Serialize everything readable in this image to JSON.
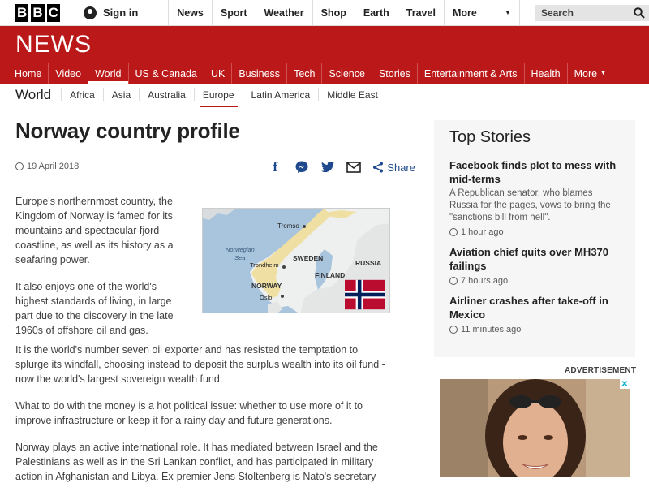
{
  "topbar": {
    "logo_letters": [
      "B",
      "B",
      "C"
    ],
    "signin_label": "Sign in",
    "nav": [
      "News",
      "Sport",
      "Weather",
      "Shop",
      "Earth",
      "Travel"
    ],
    "more_label": "More",
    "search_placeholder": "Search"
  },
  "banner": {
    "title": "NEWS",
    "color": "#bb1919"
  },
  "mainnav": {
    "items": [
      "Home",
      "Video",
      "World",
      "US & Canada",
      "UK",
      "Business",
      "Tech",
      "Science",
      "Stories",
      "Entertainment & Arts",
      "Health",
      "More"
    ],
    "active": "World"
  },
  "subnav": {
    "section": "World",
    "items": [
      "Africa",
      "Asia",
      "Australia",
      "Europe",
      "Latin America",
      "Middle East"
    ],
    "active": "Europe"
  },
  "article": {
    "title": "Norway country profile",
    "date": "19 April 2018",
    "share_label": "Share",
    "intro": [
      "Europe's northernmost country, the Kingdom of Norway is famed for its mountains and spectacular fjord coastline, as well as its history as a seafaring power.",
      "It also enjoys one of the world's highest standards of living, in large part due to the discovery in the late 1960s of offshore oil and gas."
    ],
    "body": [
      "It is the world's number seven oil exporter and has resisted the temptation to splurge its windfall, choosing instead to deposit the surplus wealth into its oil fund - now the world's largest sovereign wealth fund.",
      "What to do with the money is a hot political issue: whether to use more of it to improve infrastructure or keep it for a rainy day and future generations.",
      "Norway plays an active international role. It has mediated between Israel and the Palestinians as well as in the Sri Lankan conflict, and has participated in military action in Afghanistan and Libya. Ex-premier Jens Stoltenberg is Nato's secretary"
    ],
    "map_labels": {
      "tromso": "Tromso",
      "sea": "Norwegian\nSea",
      "sweden": "SWEDEN",
      "finland": "FINLAND",
      "russia": "RUSSIA",
      "trondheim": "Trondheim",
      "norway": "NORWAY",
      "oslo": "Oslo"
    }
  },
  "sidebar": {
    "title": "Top Stories",
    "stories": [
      {
        "headline": "Facebook finds plot to mess with mid-terms",
        "summary": "A Republican senator, who blames Russia for the pages, vows to bring the \"sanctions bill from hell\".",
        "time": "1 hour ago"
      },
      {
        "headline": "Aviation chief quits over MH370 failings",
        "summary": "",
        "time": "7 hours ago"
      },
      {
        "headline": "Airliner crashes after take-off in Mexico",
        "summary": "",
        "time": "11 minutes ago"
      }
    ]
  },
  "ad": {
    "label": "ADVERTISEMENT",
    "close": "✕"
  }
}
